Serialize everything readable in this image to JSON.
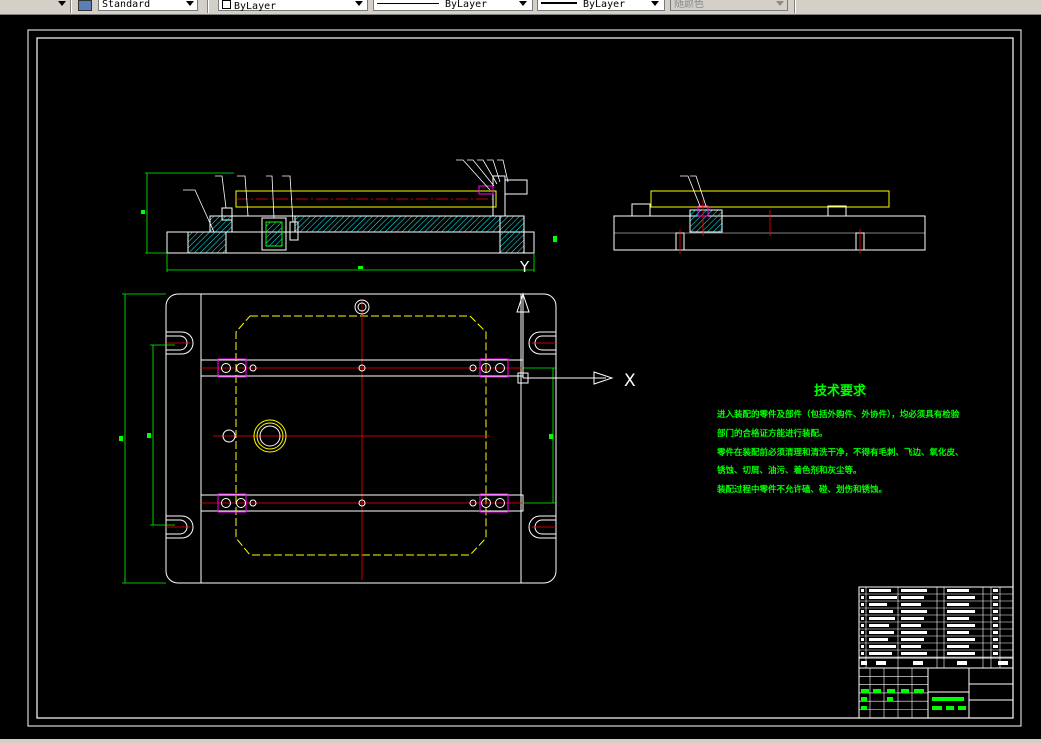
{
  "toolbar": {
    "text_style": "Standard",
    "layer_color": "ByLayer",
    "linetype": "ByLayer",
    "lineweight": "ByLayer",
    "plot_style": "随颜色"
  },
  "drawing": {
    "axis_y": "Y",
    "axis_x": "X",
    "tech_title": "技术要求",
    "tech_lines": [
      "进入装配的零件及部件（包括外购件、外协件），均必须具有检验",
      "部门的合格证方能进行装配。",
      "零件在装配前必须清理和清洗干净，不得有毛刺、飞边、氧化皮、",
      "锈蚀、切屑、油污、着色剂和灰尘等。",
      "装配过程中零件不允许磕、碰、划伤和锈蚀。"
    ]
  },
  "colors": {
    "background": "#000000",
    "frame": "#ffffff",
    "outline": "#ffffff",
    "center_line": "#ff0000",
    "hatch": "#00ffff",
    "guide_plate": "#ffff00",
    "dimension": "#00ff00",
    "clamp": "#ff00ff",
    "title_block": "#ffffff"
  },
  "icons": {
    "text_style": "text-style-icon",
    "axis_arrow": "ucs-arrow-icon"
  }
}
